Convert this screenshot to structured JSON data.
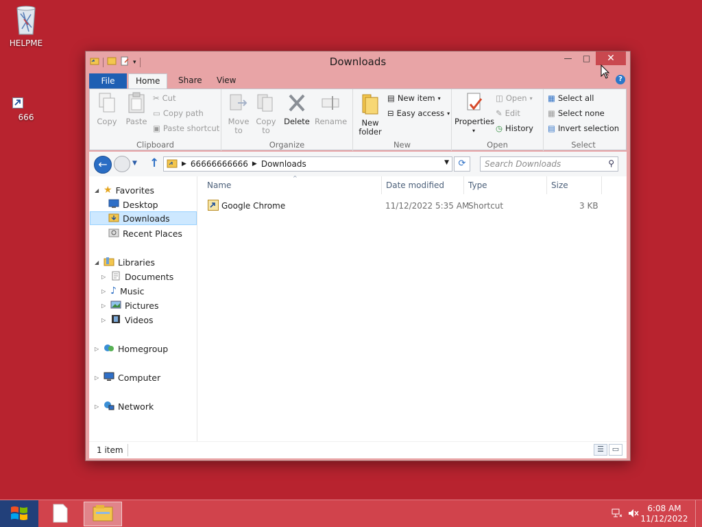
{
  "desktop": {
    "icons": [
      {
        "label": "HELPME",
        "icon": "recycle-bin-icon"
      },
      {
        "label": "666",
        "icon": "shortcut-icon"
      }
    ]
  },
  "window": {
    "title": "Downloads",
    "controls": {
      "minimize": "—",
      "maximize": "□",
      "close": "✕"
    }
  },
  "ribbon": {
    "tabs": [
      {
        "label": "File"
      },
      {
        "label": "Home"
      },
      {
        "label": "Share"
      },
      {
        "label": "View"
      }
    ],
    "help": "?",
    "groups": {
      "clipboard": {
        "label": "Clipboard",
        "copy": "Copy",
        "paste": "Paste",
        "cut": "Cut",
        "copy_path": "Copy path",
        "paste_shortcut": "Paste shortcut"
      },
      "organize": {
        "label": "Organize",
        "move_to_1": "Move",
        "move_to_2": "to",
        "copy_to_1": "Copy",
        "copy_to_2": "to",
        "delete": "Delete",
        "rename": "Rename"
      },
      "new": {
        "label": "New",
        "new_folder_1": "New",
        "new_folder_2": "folder",
        "new_item": "New item",
        "easy_access": "Easy access"
      },
      "open": {
        "label": "Open",
        "properties": "Properties",
        "open": "Open",
        "edit": "Edit",
        "history": "History"
      },
      "select": {
        "label": "Select",
        "select_all": "Select all",
        "select_none": "Select none",
        "invert": "Invert selection"
      }
    }
  },
  "address": {
    "path": [
      "66666666666",
      "Downloads"
    ],
    "search_placeholder": "Search Downloads"
  },
  "nav": {
    "favorites": "Favorites",
    "desktop": "Desktop",
    "downloads": "Downloads",
    "recent": "Recent Places",
    "libraries": "Libraries",
    "documents": "Documents",
    "music": "Music",
    "pictures": "Pictures",
    "videos": "Videos",
    "homegroup": "Homegroup",
    "computer": "Computer",
    "network": "Network"
  },
  "files": {
    "columns": {
      "name": "Name",
      "date": "Date modified",
      "type": "Type",
      "size": "Size"
    },
    "rows": [
      {
        "name": "Google Chrome",
        "date": "11/12/2022 5:35 AM",
        "type": "Shortcut",
        "size": "3 KB"
      }
    ]
  },
  "status": {
    "count": "1 item"
  },
  "taskbar": {
    "time": "6:08 AM",
    "date": "11/12/2022"
  },
  "colors": {
    "desktop": "#b8232f",
    "accent": "#1e5fb3",
    "selection": "#cde8ff"
  }
}
